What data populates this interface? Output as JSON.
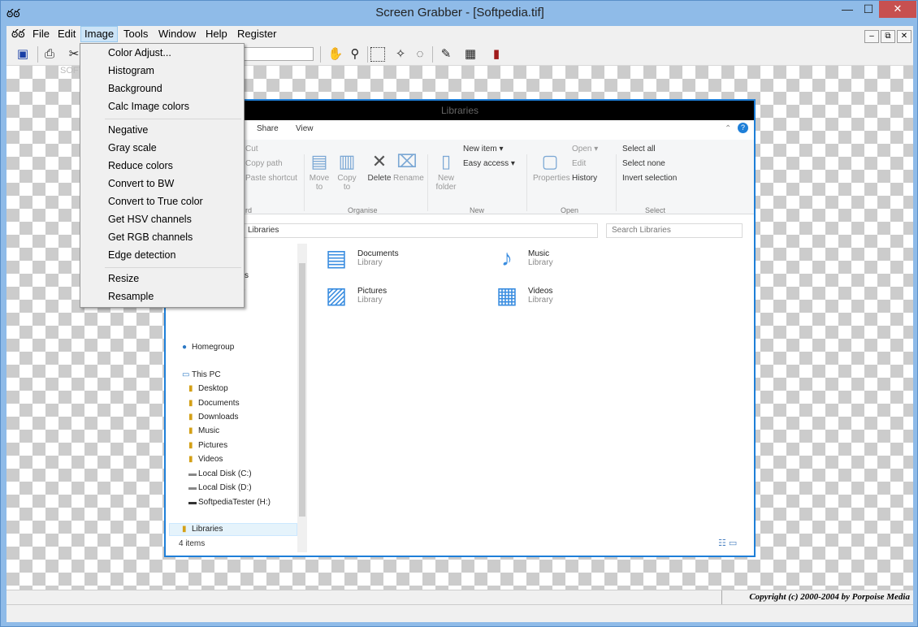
{
  "window": {
    "title": "Screen Grabber - [Softpedia.tif]",
    "logo": "ఠఠ",
    "min": "—",
    "max": "☐",
    "close": "✕"
  },
  "menubar": {
    "items": [
      "File",
      "Edit",
      "Image",
      "Tools",
      "Window",
      "Help",
      "Register"
    ],
    "mdi": [
      "–",
      "⧉",
      "✕"
    ]
  },
  "image_menu": {
    "items": [
      "Color Adjust...",
      "Histogram",
      "Background",
      "Calc Image colors",
      "Negative",
      "Gray scale",
      "Reduce colors",
      "Convert to BW",
      "Convert to True color",
      "Get HSV channels",
      "Get RGB channels",
      "Edge detection",
      "Resize",
      "Resample"
    ]
  },
  "canvas": {
    "watermark": "SOFTPEDIA"
  },
  "explorer": {
    "title": "Libraries",
    "tabs": [
      "Share",
      "View"
    ],
    "ribbon": {
      "cut": "Cut",
      "copy_path": "Copy path",
      "paste_shortcut": "Paste shortcut",
      "move_to": "Move to",
      "copy_to": "Copy to",
      "delete": "Delete",
      "rename": "Rename",
      "new_folder": "New folder",
      "new_item": "New item ▾",
      "easy_access": "Easy access ▾",
      "properties": "Properties",
      "open": "Open ▾",
      "edit": "Edit",
      "history": "History",
      "select_all": "Select all",
      "select_none": "Select none",
      "invert_selection": "Invert selection",
      "groups": [
        "rd",
        "Organise",
        "New",
        "Open",
        "Select"
      ]
    },
    "address": "Libraries",
    "search_placeholder": "Search Libraries",
    "nav": {
      "partial1": "cs",
      "partial2": "e",
      "homegroup": "Homegroup",
      "this_pc": "This PC",
      "items": [
        "Desktop",
        "Documents",
        "Downloads",
        "Music",
        "Pictures",
        "Videos",
        "Local Disk (C:)",
        "Local Disk (D:)",
        "SoftpediaTester (H:)"
      ],
      "libraries": "Libraries"
    },
    "libraries": [
      {
        "name": "Documents",
        "sub": "Library"
      },
      {
        "name": "Music",
        "sub": "Library"
      },
      {
        "name": "Pictures",
        "sub": "Library"
      },
      {
        "name": "Videos",
        "sub": "Library"
      }
    ],
    "status": "4 items"
  },
  "statusbar": {
    "copyright": "Copyright (c) 2000-2004 by Porpoise Media"
  }
}
